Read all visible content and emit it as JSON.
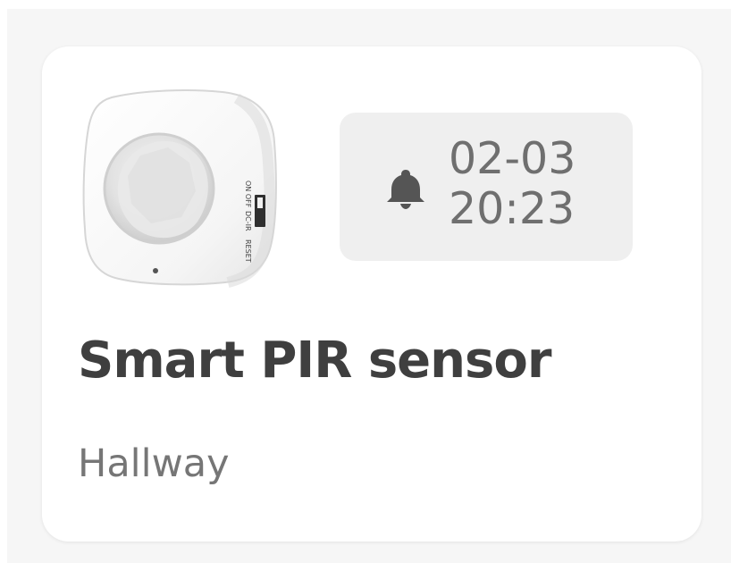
{
  "device": {
    "name": "Smart PIR sensor",
    "room": "Hallway",
    "image": {
      "description_icon": "pir-sensor-device-image",
      "switch_labels": [
        "ON OFF",
        "DC-IR",
        "RESET"
      ]
    }
  },
  "event": {
    "icon": "bell-icon",
    "date": "02-03",
    "time": "20:23"
  },
  "colors": {
    "card_background": "#ffffff",
    "pill_background": "#efefef",
    "primary_text": "#3f3f3f",
    "secondary_text": "#767676",
    "time_text": "#6f6f6f"
  }
}
